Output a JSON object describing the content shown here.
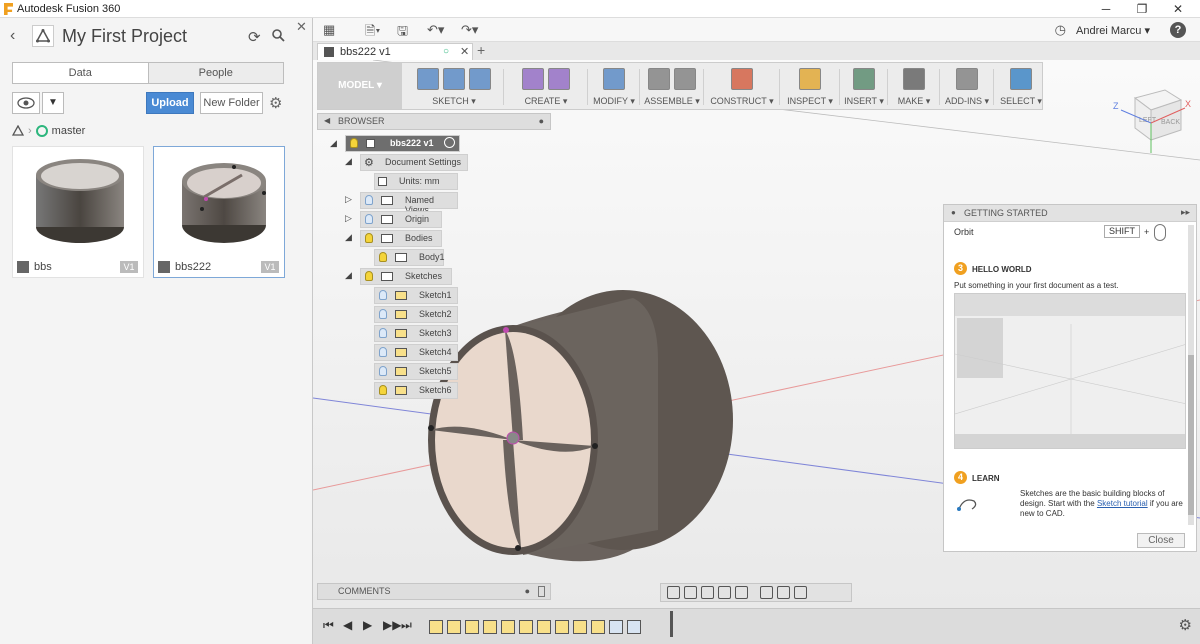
{
  "window": {
    "title": "Autodesk Fusion 360",
    "minimize": "─",
    "maximize": "❐",
    "close": "✕"
  },
  "data_panel": {
    "project_title": "My First Project",
    "tabs": [
      "Data",
      "People"
    ],
    "upload_label": "Upload",
    "new_folder_label": "New Folder",
    "branch": "master",
    "files": [
      {
        "name": "bbs",
        "version": "V1"
      },
      {
        "name": "bbs222",
        "version": "V1"
      }
    ]
  },
  "appbar": {
    "user": "Andrei Marcu ▾",
    "help": "?"
  },
  "doc_tab": {
    "name": "bbs222 v1"
  },
  "toolbar": {
    "workspace": "MODEL ▾",
    "groups": [
      {
        "label": "SKETCH ▾",
        "icons": 3,
        "color": "#4a7fc0"
      },
      {
        "label": "CREATE ▾",
        "icons": 2,
        "color": "#8a5fc0"
      },
      {
        "label": "MODIFY ▾",
        "icons": 1,
        "color": "#4a7fc0"
      },
      {
        "label": "ASSEMBLE ▾",
        "icons": 2,
        "color": "#777777"
      },
      {
        "label": "CONSTRUCT ▾",
        "icons": 1,
        "color": "#d05030"
      },
      {
        "label": "INSPECT ▾",
        "icons": 1,
        "color": "#e0a020"
      },
      {
        "label": "INSERT ▾",
        "icons": 1,
        "color": "#4a8060"
      },
      {
        "label": "MAKE ▾",
        "icons": 1,
        "color": "#555555"
      },
      {
        "label": "ADD-INS ▾",
        "icons": 1,
        "color": "#777777"
      },
      {
        "label": "SELECT ▾",
        "icons": 1,
        "color": "#2a7ac0"
      }
    ]
  },
  "browser": {
    "title": "BROWSER",
    "root": "bbs222 v1",
    "items": [
      {
        "label": "Document Settings",
        "level": 1
      },
      {
        "label": "Units: mm",
        "level": 2
      },
      {
        "label": "Named Views",
        "level": 1
      },
      {
        "label": "Origin",
        "level": 1
      },
      {
        "label": "Bodies",
        "level": 1
      },
      {
        "label": "Body1",
        "level": 2
      },
      {
        "label": "Sketches",
        "level": 1
      },
      {
        "label": "Sketch1",
        "level": 2
      },
      {
        "label": "Sketch2",
        "level": 2
      },
      {
        "label": "Sketch3",
        "level": 2
      },
      {
        "label": "Sketch4",
        "level": 2
      },
      {
        "label": "Sketch5",
        "level": 2
      },
      {
        "label": "Sketch6",
        "level": 2
      }
    ]
  },
  "getting_started": {
    "title": "GETTING STARTED",
    "orbit_label": "Orbit",
    "shift_key": "SHIFT",
    "plus": "+",
    "step3_number": "3",
    "step3_title": "HELLO WORLD",
    "step3_text": "Put something in your first document as a test.",
    "step4_number": "4",
    "step4_title": "LEARN",
    "step4_text_a": "Sketches are the basic building blocks of design. Start with the",
    "step4_link": "Sketch tutorial",
    "step4_text_b": "if you are new to CAD.",
    "close_label": "Close"
  },
  "comments": {
    "title": "COMMENTS"
  },
  "viewcube": {
    "left": "LEFT",
    "back": "BACK",
    "axis_z": "Z",
    "axis_x": "X"
  },
  "colors": {
    "accent": "#4a8ad4",
    "branch": "#2cb67d",
    "step": "#f0a020",
    "body": "#5e5650"
  }
}
